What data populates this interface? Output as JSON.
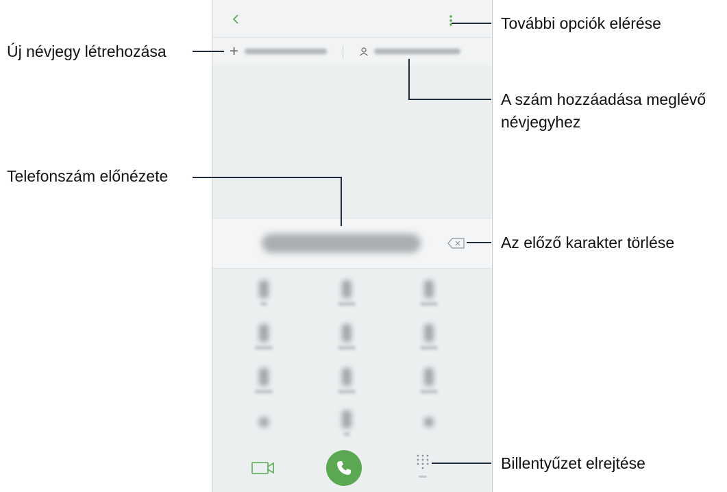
{
  "callouts": {
    "more_options": "További opciók elérése",
    "create_contact": "Új névjegy létrehozása",
    "add_to_existing_line1": "A szám hozzáadása meglévő",
    "add_to_existing_line2": "névjegyhez",
    "number_preview": "Telefonszám előnézete",
    "delete_char": "Az előző karakter törlése",
    "hide_keypad": "Billentyűzet elrejtése"
  },
  "icons": {
    "back": "back-arrow-icon",
    "more": "more-options-icon",
    "add": "plus-icon",
    "person": "person-icon",
    "backspace": "backspace-icon",
    "video": "video-call-icon",
    "call": "phone-icon",
    "keypad": "keypad-icon"
  },
  "colors": {
    "accent": "#5aa952",
    "line": "#1d2b3a"
  }
}
